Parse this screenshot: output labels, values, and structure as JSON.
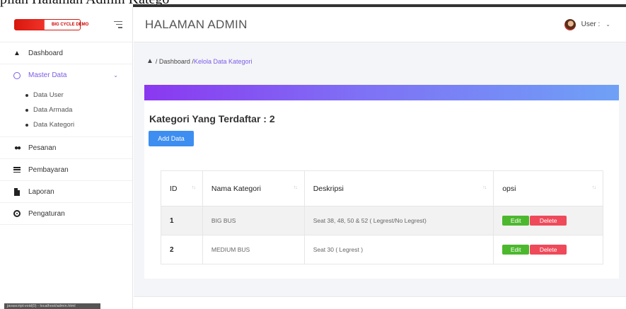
{
  "caption": {
    "text": "pilan Halaman Admin Katego"
  },
  "sidebar": {
    "logo_text": "BIG CYCLE DEMO",
    "items": [
      {
        "label": "Dashboard",
        "icon": "home-icon"
      },
      {
        "label": "Master Data",
        "icon": "circle-icon",
        "active": true
      },
      {
        "label": "Pesanan",
        "icon": "people-icon"
      },
      {
        "label": "Pembayaran",
        "icon": "list-icon"
      },
      {
        "label": "Laporan",
        "icon": "document-icon"
      },
      {
        "label": "Pengaturan",
        "icon": "gear-icon"
      }
    ],
    "submenu": [
      {
        "label": "Data User"
      },
      {
        "label": "Data Armada"
      },
      {
        "label": "Data Kategori"
      }
    ]
  },
  "status_bar": {
    "text": "javascript:void(0) - localhost/admin.html"
  },
  "header": {
    "title": "HALAMAN ADMIN",
    "user_label": "User :"
  },
  "breadcrumb": {
    "home": "/ Dashboard /",
    "current": "Kelola Data Kategori"
  },
  "content": {
    "heading": "Kategori Yang Terdaftar : 2",
    "add_button": "Add Data",
    "table": {
      "columns": [
        "ID",
        "Nama Kategori",
        "Deskripsi",
        "opsi"
      ],
      "rows": [
        {
          "id": "1",
          "nama": "BIG BUS",
          "deskripsi": "Seat 38, 48, 50 & 52 ( Legrest/No Legrest)",
          "edit": "Edit",
          "delete": "Delete"
        },
        {
          "id": "2",
          "nama": "MEDIUM BUS",
          "deskripsi": "Seat 30 ( Legrest )",
          "edit": "Edit",
          "delete": "Delete"
        }
      ]
    }
  },
  "colors": {
    "accent": "#7b5ce8",
    "banner_start": "#8a38f0",
    "banner_end": "#6fa1f6",
    "add_button": "#3d8ef0",
    "edit": "#4cb82e",
    "delete": "#ee4a5a"
  }
}
